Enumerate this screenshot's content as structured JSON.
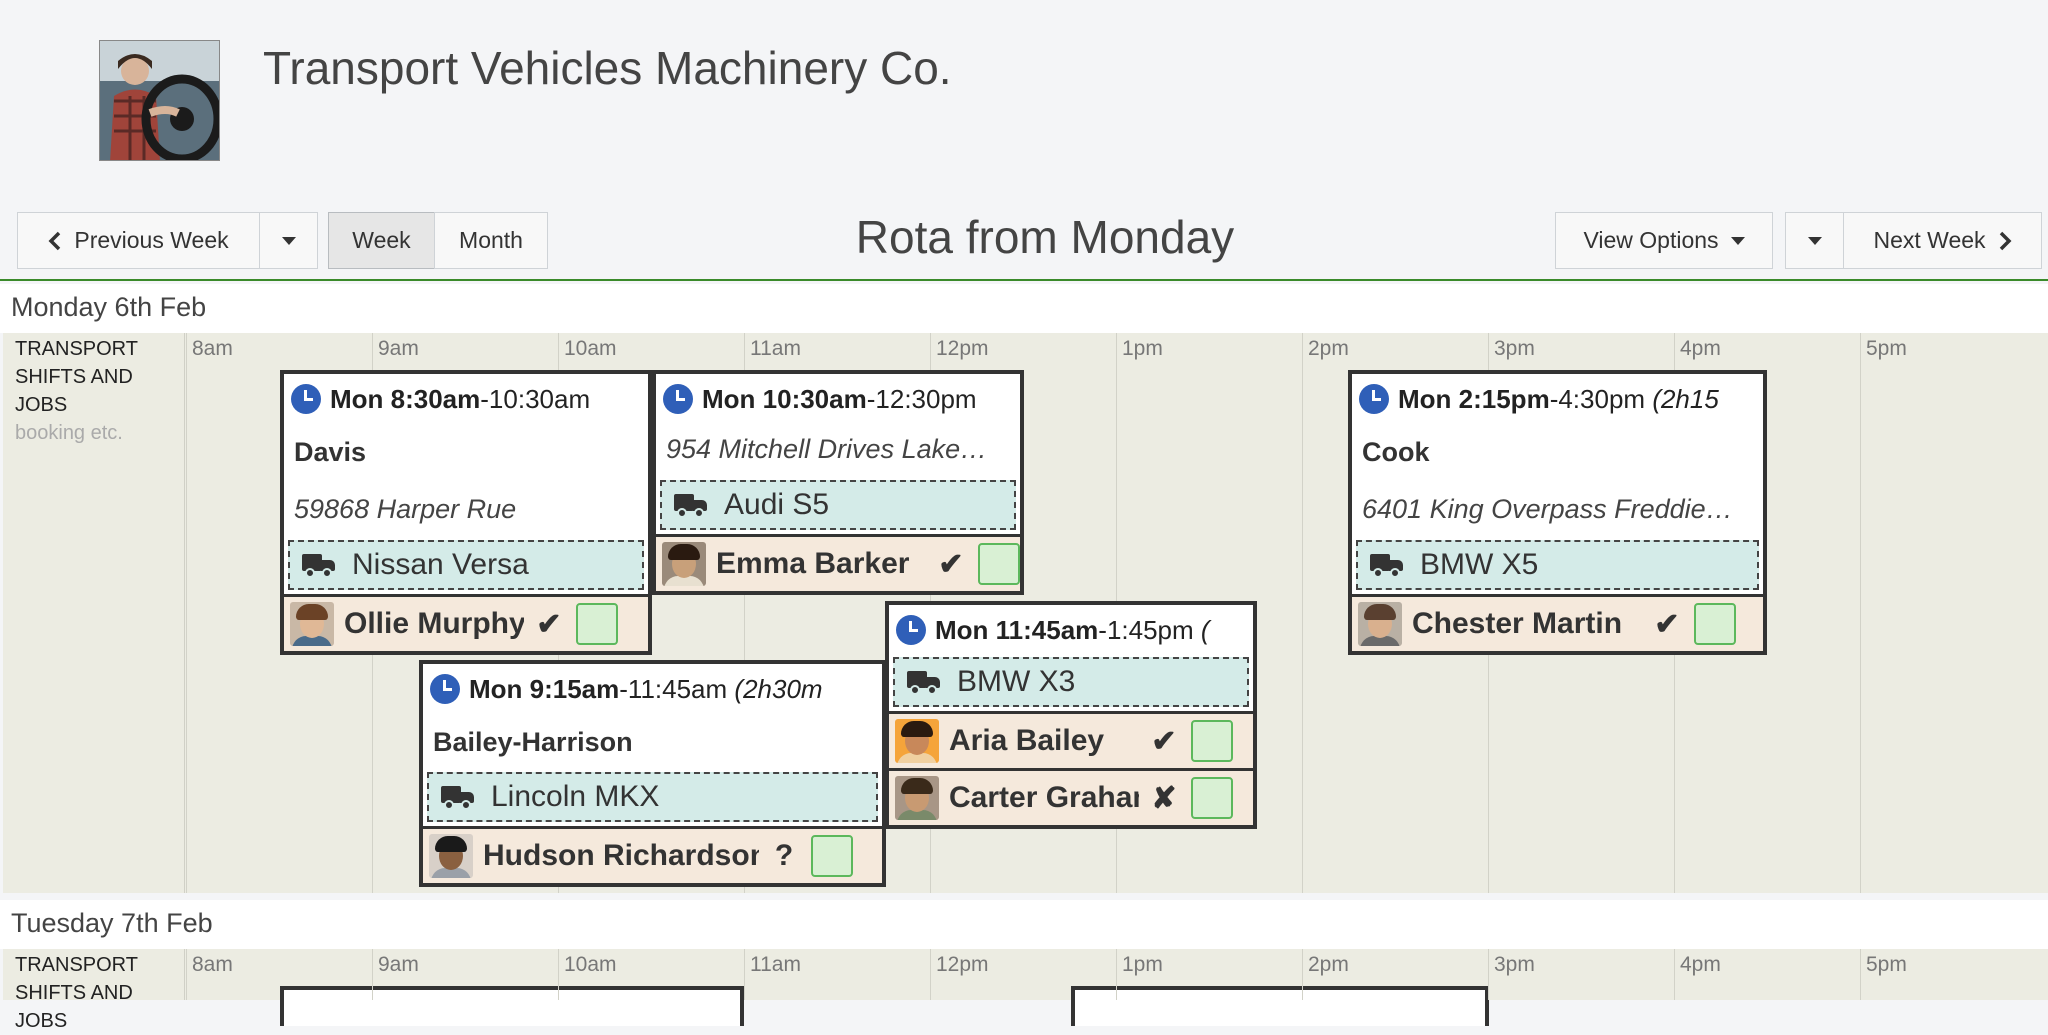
{
  "app": {
    "company": "Transport Vehicles Machinery Co."
  },
  "toolbar": {
    "prev_label": "Previous Week",
    "week_label": "Week",
    "month_label": "Month",
    "title": "Rota from Monday",
    "view_options_label": "View Options",
    "next_label": "Next Week",
    "active_view": "Week"
  },
  "hours": [
    "8am",
    "9am",
    "10am",
    "11am",
    "12pm",
    "1pm",
    "2pm",
    "3pm",
    "4pm",
    "5pm"
  ],
  "days": [
    {
      "label": "Monday 6th Feb",
      "side": {
        "title": "TRANSPORT SHIFTS AND JOBS",
        "sub": "booking etc."
      },
      "shifts": [
        {
          "start": "Mon 8:30am",
          "end": "-10:30am",
          "duration": "",
          "client": "Davis",
          "address": "59868 Harper Rue",
          "vehicle": "Nissan Versa",
          "staff": [
            {
              "name": "Ollie Murphy",
              "status": "✔"
            }
          ]
        },
        {
          "start": "Mon 10:30am",
          "end": "-12:30pm",
          "duration": "",
          "client": "",
          "address": "954 Mitchell Drives Lake…",
          "vehicle": "Audi S5",
          "staff": [
            {
              "name": "Emma Barker",
              "status": "✔"
            }
          ]
        },
        {
          "start": "Mon 2:15pm",
          "end": "-4:30pm",
          "duration": "(2h15",
          "client": "Cook",
          "address": "6401 King Overpass Freddie…",
          "vehicle": "BMW X5",
          "staff": [
            {
              "name": "Chester Martin",
              "status": "✔"
            }
          ]
        },
        {
          "start": "Mon 11:45am",
          "end": "-1:45pm",
          "duration": "(",
          "client": "",
          "address": "",
          "vehicle": "BMW X3",
          "staff": [
            {
              "name": "Aria Bailey",
              "status": "✔"
            },
            {
              "name": "Carter Graham",
              "status": "✘"
            }
          ]
        },
        {
          "start": "Mon 9:15am",
          "end": "-11:45am",
          "duration": "(2h30m",
          "client": "Bailey-Harrison",
          "address": "",
          "vehicle": "Lincoln MKX",
          "staff": [
            {
              "name": "Hudson Richardson",
              "status": "?"
            }
          ]
        }
      ]
    },
    {
      "label": "Tuesday 7th Feb",
      "side": {
        "title": "TRANSPORT SHIFTS AND JOBS",
        "sub": ""
      },
      "shifts": []
    }
  ]
}
